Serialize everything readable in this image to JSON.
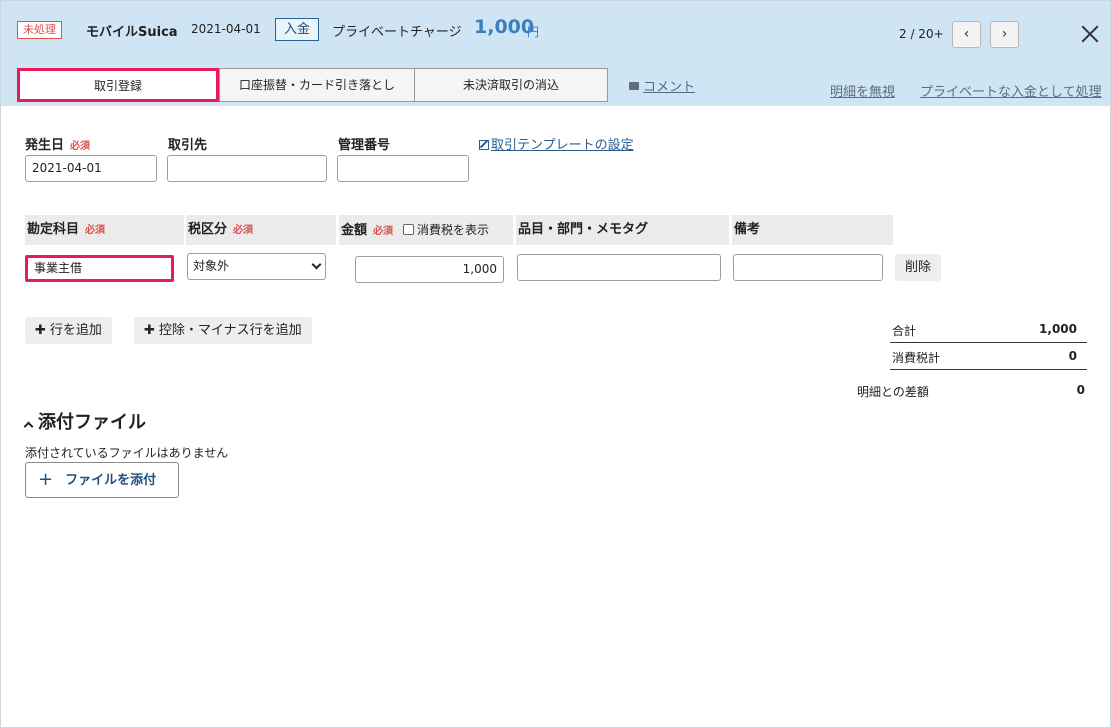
{
  "header": {
    "status_badge": "未処理",
    "account_name": "モバイルSuica",
    "date": "2021-04-01",
    "type_badge": "入金",
    "description": "プライベートチャージ",
    "amount": "1,000",
    "currency": "円",
    "pager": "2 / 20+",
    "prev_icon": "‹",
    "next_icon": "›",
    "close_icon": "close-icon"
  },
  "tabs": [
    {
      "label": "取引登録"
    },
    {
      "label": "口座振替・カード引き落とし"
    },
    {
      "label": "未決済取引の消込"
    }
  ],
  "links": {
    "comment": "コメント",
    "ignore": "明細を無視",
    "private": "プライベートな入金として処理"
  },
  "form": {
    "date_label": "発生日",
    "required": "必須",
    "date_value": "2021-04-01",
    "partner_label": "取引先",
    "partner_value": "",
    "mgmt_label": "管理番号",
    "mgmt_value": "",
    "template_link": "取引テンプレートの設定"
  },
  "table": {
    "account_label": "勘定科目",
    "tax_label": "税区分",
    "amount_label": "金額",
    "show_tax_label": "消費税を表示",
    "tags_label": "品目・部門・メモタグ",
    "note_label": "備考",
    "row": {
      "account": "事業主借",
      "tax": "対象外",
      "amount": "1,000",
      "tags": "",
      "note": "",
      "delete": "削除"
    }
  },
  "actions": {
    "add_row": "行を追加",
    "add_deduction_row": "控除・マイナス行を追加"
  },
  "totals": {
    "total_label": "合計",
    "total_value": "1,000",
    "tax_label": "消費税計",
    "tax_value": "0",
    "diff_label": "明細との差額",
    "diff_value": "0"
  },
  "attachments": {
    "title": "添付ファイル",
    "empty": "添付されているファイルはありません",
    "attach_button": "ファイルを添付"
  }
}
